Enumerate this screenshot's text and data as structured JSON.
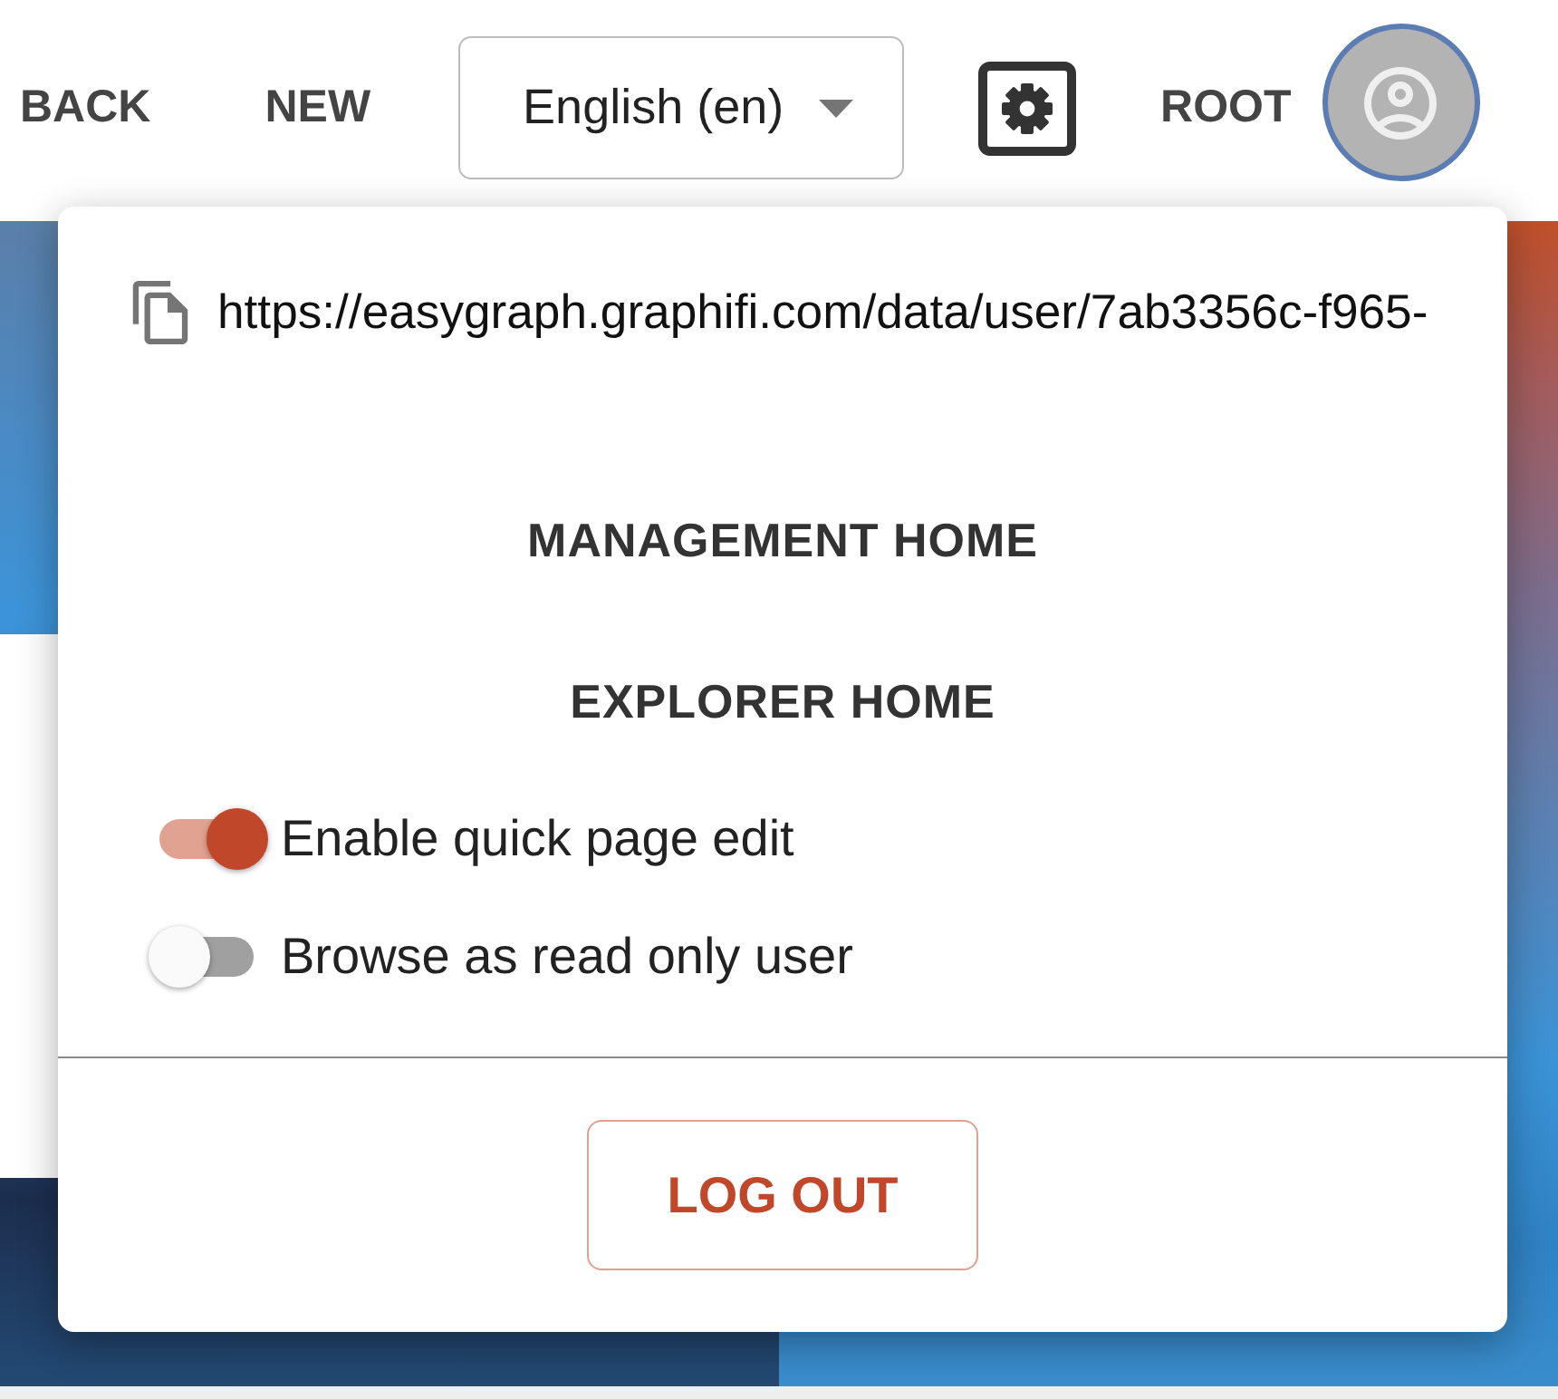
{
  "header": {
    "nav_links": [
      "BACK",
      "NEW"
    ],
    "language_select": {
      "value": "English (en)"
    },
    "user_name": "ROOT"
  },
  "user_menu": {
    "url": "https://easygraph.graphifi.com/data/user/7ab3356c-f965-",
    "links": [
      "MANAGEMENT HOME",
      "EXPLORER HOME"
    ],
    "toggles": [
      {
        "label": "Enable quick page edit",
        "on": true
      },
      {
        "label": "Browse as read only user",
        "on": false
      }
    ],
    "logout_button": "LOG OUT"
  }
}
